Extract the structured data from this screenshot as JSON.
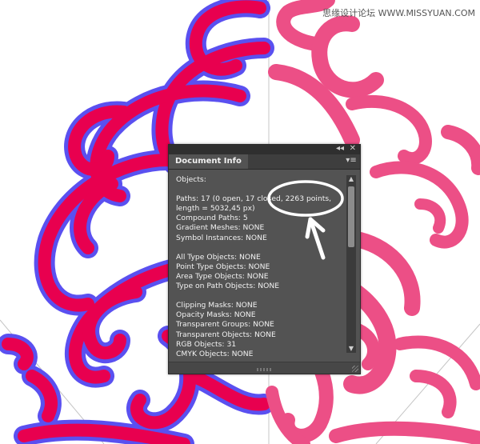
{
  "watermark": "思缘设计论坛 WWW.MISSYUAN.COM",
  "panel": {
    "title": "Document Info",
    "collapse_icon": "double-chevron-icon",
    "close_icon": "close-icon",
    "menu_icon": "panel-menu-icon",
    "lines": [
      "Objects:",
      "",
      "Paths: 17 (0 open, 17 closed, 2263 points,",
      "length = 5032,45 px)",
      "Compound Paths: 5",
      "Gradient Meshes: NONE",
      "Symbol Instances: NONE",
      "",
      "All Type Objects: NONE",
      "Point Type Objects: NONE",
      "Area Type Objects: NONE",
      "Type on Path Objects: NONE",
      "",
      "Clipping Masks: NONE",
      "Opacity Masks: NONE",
      "Transparent Groups: NONE",
      "Transparent Objects: NONE",
      "RGB Objects: 31",
      "CMYK Objects: NONE"
    ]
  },
  "colors": {
    "swirl_left": "#e8004f",
    "swirl_outline": "#5a50f0",
    "swirl_right": "#ec4f86",
    "panel_bg": "#535353",
    "panel_text": "#f2f2f2"
  }
}
